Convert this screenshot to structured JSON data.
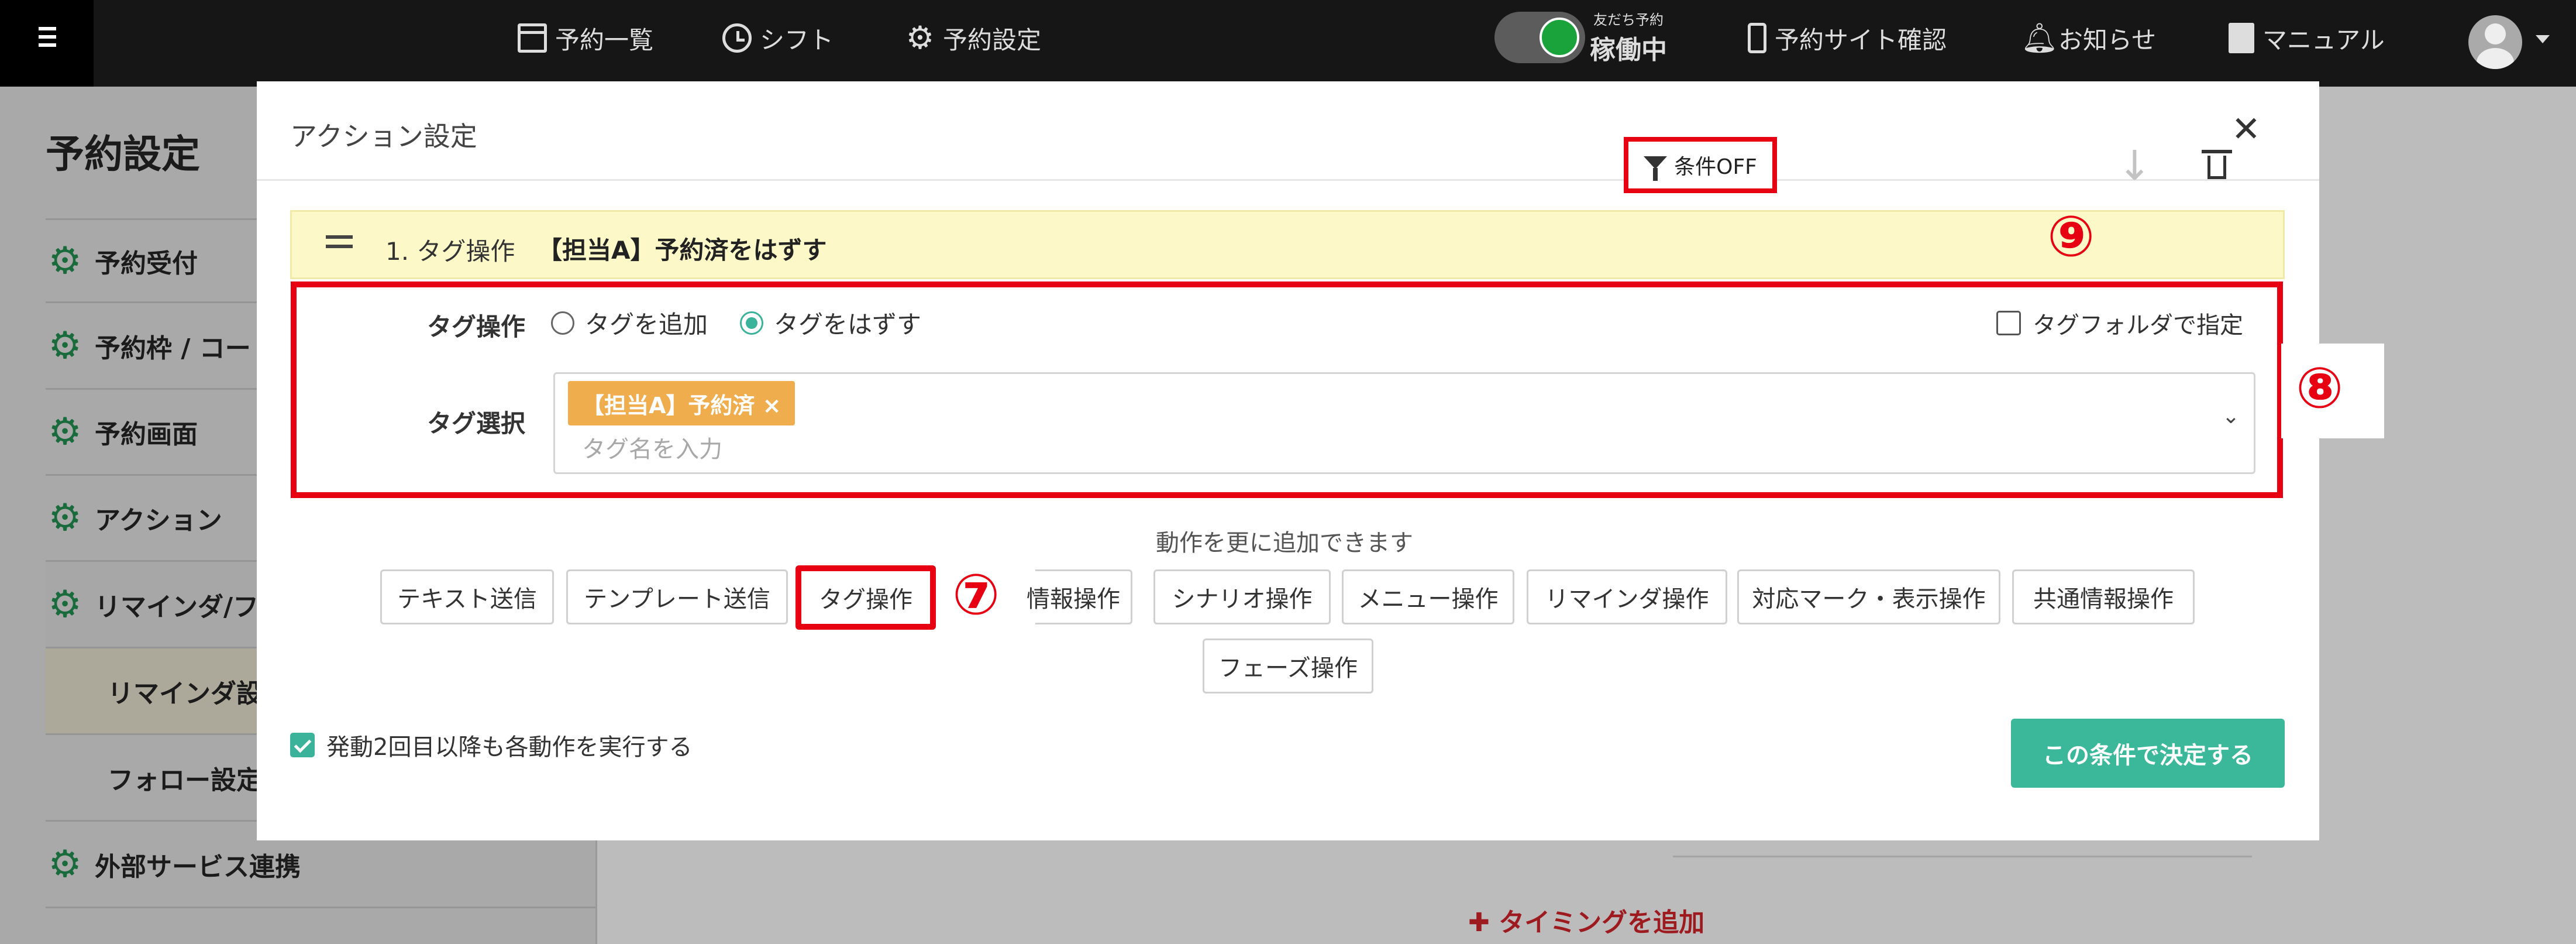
{
  "topbar": {
    "nav": [
      {
        "label": "予約一覧",
        "icon": "calendar-icon"
      },
      {
        "label": "シフト",
        "icon": "clock-icon"
      },
      {
        "label": "予約設定",
        "icon": "gear-icon"
      }
    ],
    "toggle_small": "友だち予約",
    "toggle_big": "稼働中",
    "right_nav": [
      {
        "label": "予約サイト確認",
        "icon": "smartphone-icon"
      },
      {
        "label": "お知らせ",
        "icon": "bell-icon"
      },
      {
        "label": "マニュアル",
        "icon": "book-icon"
      }
    ]
  },
  "sidebar": {
    "title": "予約設定",
    "items": [
      {
        "label": "予約受付"
      },
      {
        "label": "予約枠 / コー"
      },
      {
        "label": "予約画面"
      },
      {
        "label": "アクション"
      },
      {
        "label": "リマインダ/フ"
      },
      {
        "label": "リマインダ設"
      },
      {
        "label": "フォロー設定"
      },
      {
        "label": "外部サービス連携"
      }
    ]
  },
  "main": {
    "add_timing": "✚ タイミングを追加"
  },
  "modal": {
    "title": "アクション設定",
    "close_symbol": "✕",
    "action": {
      "number_label": "1. タグ操作",
      "name": "【担当A】予約済をはずす",
      "condition_label": "条件OFF"
    },
    "tag_op": {
      "label": "タグ操作",
      "options": [
        "タグを追加",
        "タグをはずす"
      ],
      "selected": "タグをはずす",
      "folder_label": "タグフォルダで指定"
    },
    "tag_select": {
      "label": "タグ選択",
      "chip": "【担当A】予約済 ×",
      "placeholder": "タグ名を入力"
    },
    "more_label": "動作を更に追加できます",
    "op_buttons": [
      "テキスト送信",
      "テンプレート送信",
      "タグ操作",
      "情報操作",
      "シナリオ操作",
      "メニュー操作",
      "リマインダ操作",
      "対応マーク・表示操作",
      "共通情報操作",
      "フェーズ操作"
    ],
    "repeat_label": "発動2回目以降も各動作を実行する",
    "decide_label": "この条件で決定する"
  },
  "annotations": {
    "seven": "⑦",
    "eight": "⑧",
    "nine": "⑨"
  },
  "colors": {
    "accent_green": "#3bb89a",
    "highlight_red": "#e60012",
    "tag_chip": "#f0ad4e",
    "action_header_bg": "#fdf8c8"
  }
}
